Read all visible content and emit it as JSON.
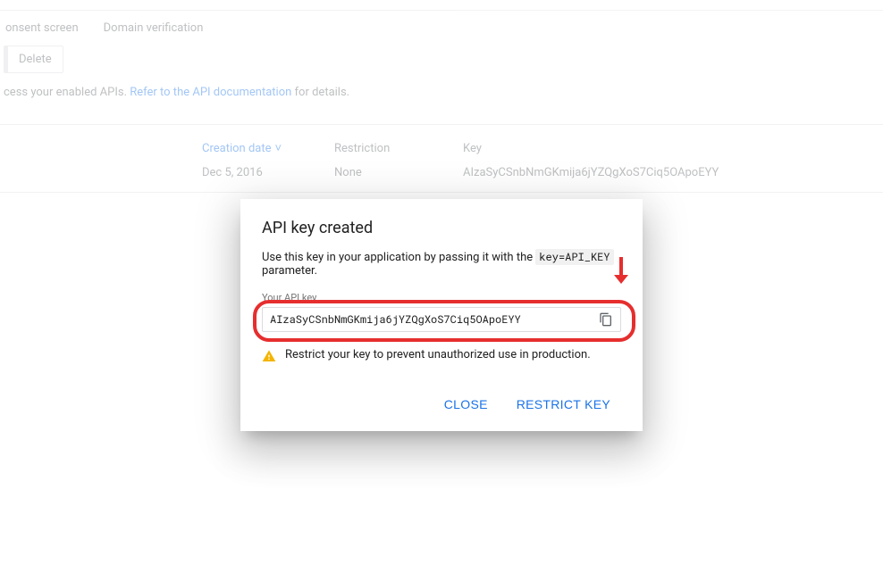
{
  "bg": {
    "nav": {
      "consent": "onsent screen",
      "domain": "Domain verification"
    },
    "toolbar": {
      "delete": "Delete"
    },
    "desc": {
      "prefix": "cess your enabled APIs. ",
      "link": "Refer to the API documentation",
      "suffix": " for details."
    },
    "table": {
      "headers": {
        "date": "Creation date",
        "restriction": "Restriction",
        "key": "Key"
      },
      "row": {
        "date": "Dec 5, 2016",
        "restriction": "None",
        "key": "AIzaSyCSnbNmGKmija6jYZQgXoS7Ciq5OApoEYY"
      },
      "chevron": "˅"
    }
  },
  "modal": {
    "title": "API key created",
    "desc_before": "Use this key in your application by passing it with the ",
    "desc_code": "key=API_KEY",
    "desc_after": " parameter.",
    "field_label": "Your API key",
    "api_key": "AIzaSyCSnbNmGKmija6jYZQgXoS7Ciq5OApoEYY",
    "warning": "Restrict your key to prevent unauthorized use in production.",
    "close": "Close",
    "restrict": "Restrict key"
  }
}
